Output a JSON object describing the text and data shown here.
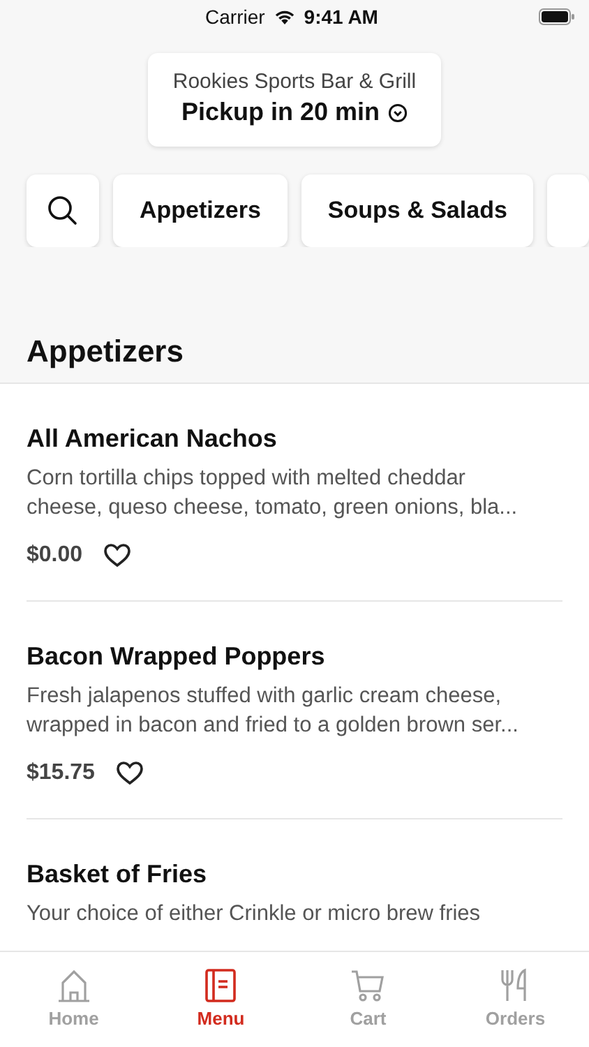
{
  "status_bar": {
    "carrier": "Carrier",
    "time": "9:41 AM"
  },
  "header": {
    "restaurant": "Rookies Sports Bar & Grill",
    "pickup": "Pickup in 20 min"
  },
  "categories": [
    {
      "label": "Appetizers",
      "selected": false
    },
    {
      "label": "Soups & Salads",
      "selected": false
    }
  ],
  "section_title": "Appetizers",
  "items": [
    {
      "name": "All American Nachos",
      "description_lines": [
        "Corn tortilla chips topped with melted cheddar",
        "cheese, queso cheese, tomato, green onions, bla..."
      ],
      "price": "$0.00",
      "favorite": false
    },
    {
      "name": "Bacon Wrapped Poppers",
      "description_lines": [
        "Fresh jalapenos stuffed with garlic cream cheese,",
        "wrapped in bacon and fried to a golden brown ser..."
      ],
      "price": "$15.75",
      "favorite": false
    },
    {
      "name": "Basket of Fries",
      "description_lines": [
        "Your choice of either Crinkle or micro brew fries"
      ]
    }
  ],
  "tab_bar": [
    {
      "kind": "home",
      "label": "Home",
      "selected": false
    },
    {
      "kind": "menu",
      "label": "Menu",
      "selected": true
    },
    {
      "kind": "cart",
      "label": "Cart",
      "selected": false
    },
    {
      "kind": "orders",
      "label": "Orders",
      "selected": false
    }
  ]
}
